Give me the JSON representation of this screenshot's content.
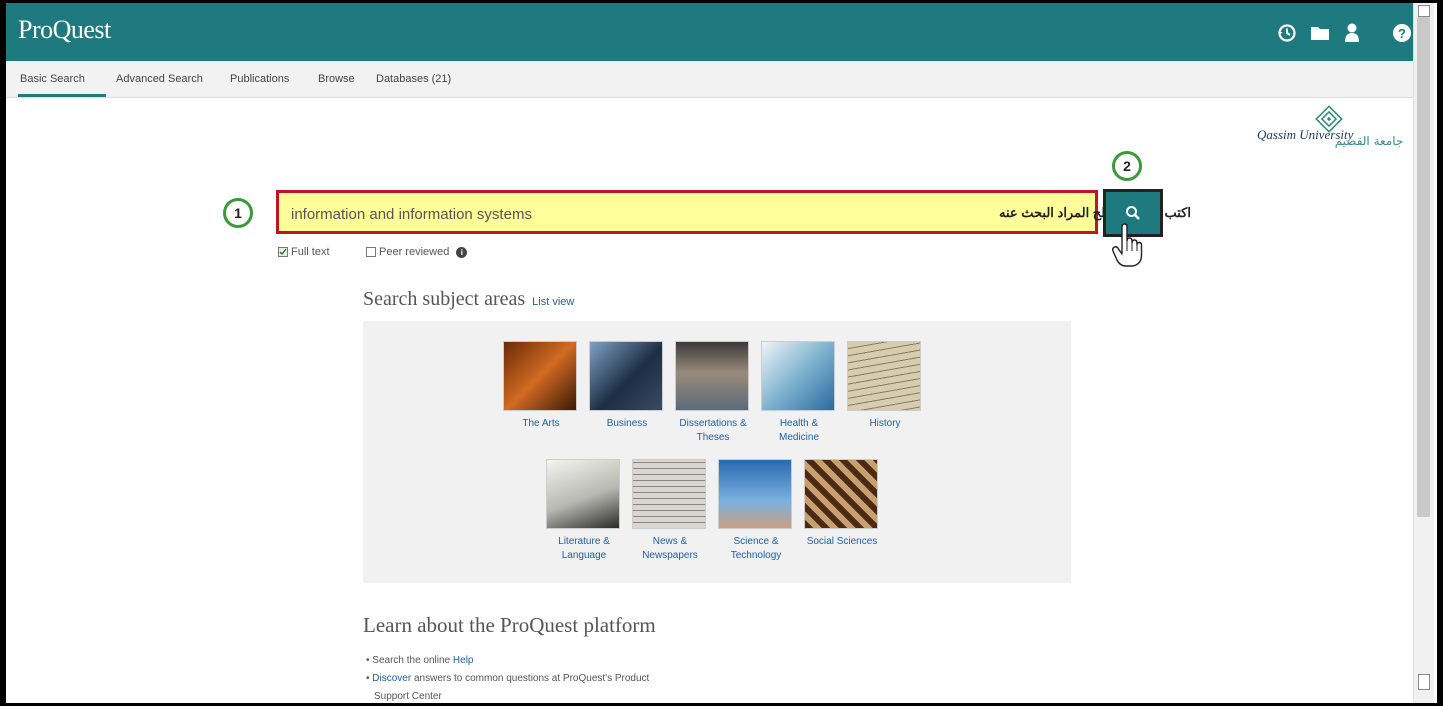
{
  "header": {
    "logo": "ProQuest",
    "icons": [
      "history-icon",
      "folder-icon",
      "user-icon",
      "help-icon"
    ]
  },
  "nav": {
    "tabs": [
      {
        "label": "Basic Search",
        "active": true
      },
      {
        "label": "Advanced Search",
        "active": false
      },
      {
        "label": "Publications",
        "active": false
      },
      {
        "label": "Browse",
        "active": false
      },
      {
        "label": "Databases (21)",
        "active": false
      }
    ]
  },
  "university_logo": {
    "english": "Qassim University",
    "arabic": "جامعة القصيم"
  },
  "search": {
    "value": "information and information systems",
    "annotation": "اكتب هنا المصطلح المراد البحث عنه",
    "step1": "1",
    "step2": "2",
    "full_text_label": "Full text",
    "full_text_checked": true,
    "peer_reviewed_label": "Peer reviewed",
    "peer_reviewed_checked": false
  },
  "subjects": {
    "heading": "Search subject areas",
    "list_view": "List view",
    "row1": [
      {
        "label": "The Arts",
        "color": "#b2551c"
      },
      {
        "label": "Business",
        "color": "#2a3f5e"
      },
      {
        "label": "Dissertations & Theses",
        "color": "#6c6f73"
      },
      {
        "label": "Health & Medicine",
        "color": "#7fb3cf"
      },
      {
        "label": "History",
        "color": "#c9bca0"
      }
    ],
    "row2": [
      {
        "label": "Literature & Language",
        "color": "#8a8a86"
      },
      {
        "label": "News & Newspapers",
        "color": "#a9a6a0"
      },
      {
        "label": "Science & Technology",
        "color": "#4a86c6"
      },
      {
        "label": "Social Sciences",
        "color": "#8a5a34"
      }
    ]
  },
  "learn": {
    "heading": "Learn about the ProQuest platform",
    "item1_text": "Search the online",
    "item1_link": "Help",
    "item2_link": "Discover",
    "item2_text": "answers to common questions at ProQuest's Product",
    "item3_text": "Support Center"
  },
  "colors": {
    "brand": "#1f7a80",
    "highlight": "#ffff99",
    "annotation_border": "#c0142a",
    "step_circle": "#3a9a3a",
    "link": "#1f5fa0"
  }
}
